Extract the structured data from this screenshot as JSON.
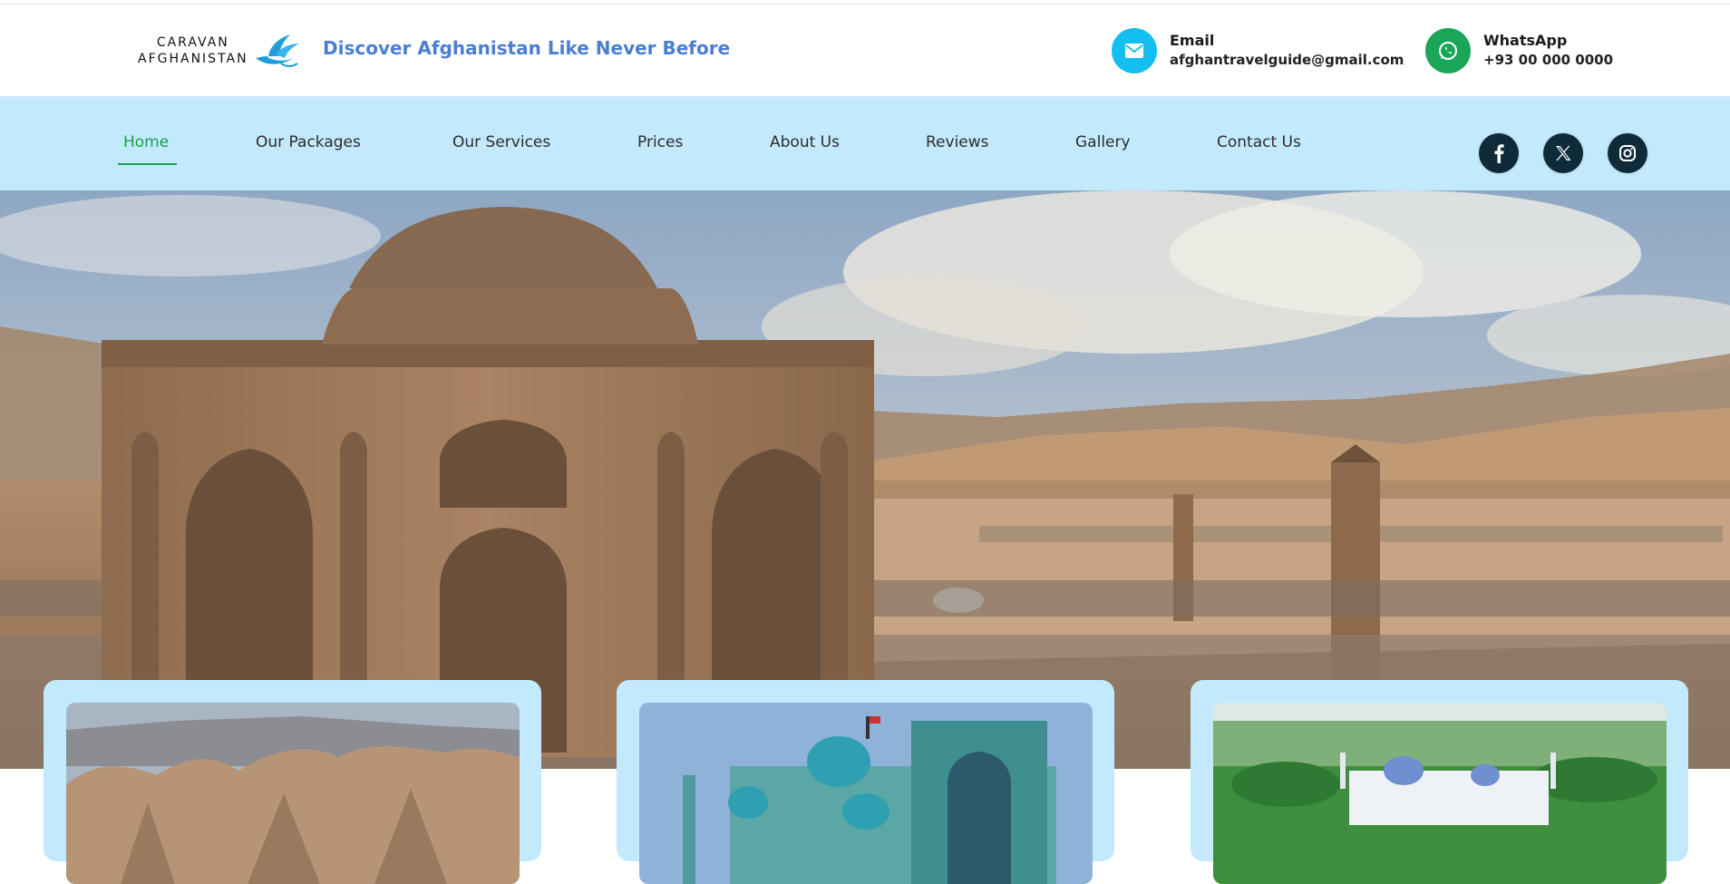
{
  "brand": {
    "logo_line1": "CARAVAN",
    "logo_line2": "AFGHANISTAN",
    "tagline": "Discover Afghanistan Like Never Before"
  },
  "contacts": {
    "email": {
      "label": "Email",
      "value": "afghantravelguide@gmail.com",
      "icon": "envelope-icon",
      "color": "#12bff0"
    },
    "whatsapp": {
      "label": "WhatsApp",
      "value": "+93 00 000 0000",
      "icon": "whatsapp-icon",
      "color": "#1aa558"
    }
  },
  "nav": {
    "items": [
      {
        "label": "Home",
        "active": true
      },
      {
        "label": "Our Packages"
      },
      {
        "label": "Our Services"
      },
      {
        "label": "Prices"
      },
      {
        "label": "About Us"
      },
      {
        "label": "Reviews"
      },
      {
        "label": "Gallery"
      },
      {
        "label": "Contact Us"
      }
    ],
    "social": [
      {
        "icon": "facebook-icon"
      },
      {
        "icon": "x-twitter-icon"
      },
      {
        "icon": "instagram-icon"
      }
    ]
  },
  "hero": {
    "image": "historic-domed-brick-tomb-and-minaret-with-mountains"
  },
  "cards": [
    {
      "image": "eroded-sandstone-cliffs-with-caves"
    },
    {
      "image": "blue-tiled-mosque"
    },
    {
      "image": "white-shrine-in-green-valley"
    }
  ],
  "colors": {
    "accent": "#16a34a",
    "nav_background": "#c3e9fc",
    "tagline": "#4a7fd0",
    "social_background": "#0f2b3a"
  }
}
